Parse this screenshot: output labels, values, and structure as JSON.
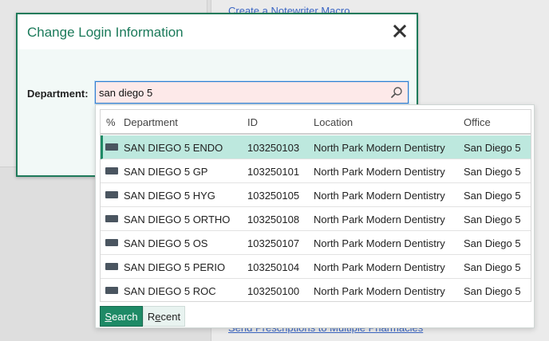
{
  "background": {
    "link_top": "Create a Notewriter Macro",
    "link_bottom": "Send Prescriptions to Multiple Pharmacies"
  },
  "modal": {
    "title": "Change Login Information",
    "close_icon": "close-icon",
    "department_label": "Department:",
    "search_value": "san diego 5",
    "search_icon": "search-icon"
  },
  "dropdown": {
    "columns": [
      "%",
      "Department",
      "ID",
      "Location",
      "Office"
    ],
    "rows": [
      {
        "department": "SAN DIEGO 5 ENDO",
        "id": "103250103",
        "location": "North Park Modern Dentistry",
        "office": "San Diego 5"
      },
      {
        "department": "SAN DIEGO 5 GP",
        "id": "103250101",
        "location": "North Park Modern Dentistry",
        "office": "San Diego 5"
      },
      {
        "department": "SAN DIEGO 5 HYG",
        "id": "103250105",
        "location": "North Park Modern Dentistry",
        "office": "San Diego 5"
      },
      {
        "department": "SAN DIEGO 5 ORTHO",
        "id": "103250108",
        "location": "North Park Modern Dentistry",
        "office": "San Diego 5"
      },
      {
        "department": "SAN DIEGO 5 OS",
        "id": "103250107",
        "location": "North Park Modern Dentistry",
        "office": "San Diego 5"
      },
      {
        "department": "SAN DIEGO 5 PERIO",
        "id": "103250104",
        "location": "North Park Modern Dentistry",
        "office": "San Diego 5"
      },
      {
        "department": "SAN DIEGO 5 ROC",
        "id": "103250100",
        "location": "North Park Modern Dentistry",
        "office": "San Diego 5"
      }
    ],
    "search_button": {
      "first": "S",
      "rest": "earch"
    },
    "recent_button": {
      "first": "R",
      "mid": "e",
      "rest": "cent"
    }
  },
  "colors": {
    "accent": "#1e8a66",
    "selected_row": "#bde8de",
    "input_bg": "#fde9e9"
  }
}
